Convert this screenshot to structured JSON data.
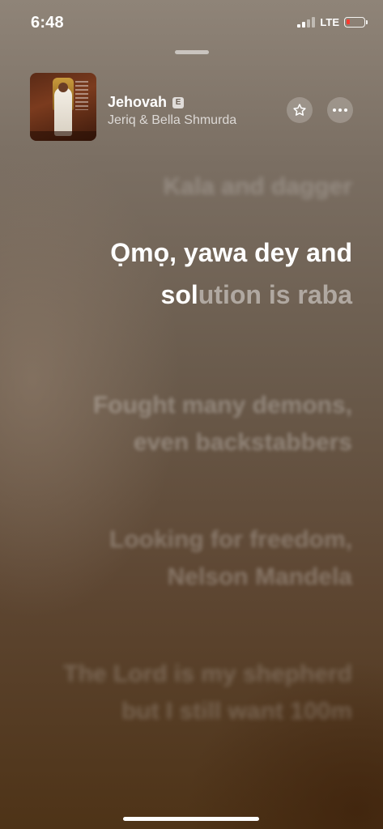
{
  "status_bar": {
    "time": "6:48",
    "network": "LTE",
    "battery_color": "#ff3b30"
  },
  "now_playing": {
    "title": "Jehovah",
    "explicit_badge": "E",
    "artist": "Jeriq & Bella Shmurda",
    "star_icon": "star-icon",
    "more_icon": "ellipsis-icon"
  },
  "lyrics": {
    "previous": "Kala and dagger",
    "current_sung": "Ọmọ, yawa dey and sol",
    "current_unsung": "ution is raba",
    "next": [
      "Fought many demons, even backstabbers",
      "Looking for freedom, Nelson Mandela",
      "The Lord is my shepherd but I still want 100m"
    ]
  }
}
